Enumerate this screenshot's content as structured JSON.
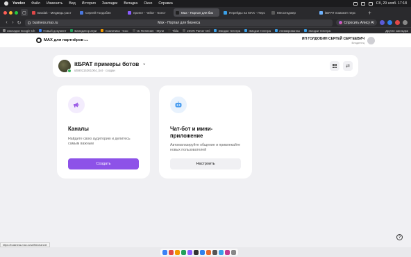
{
  "menubar": {
    "app": "Yandex",
    "items": [
      "Файл",
      "Изменить",
      "Вид",
      "История",
      "Закладки",
      "Вкладка",
      "Окно",
      "Справка"
    ],
    "clock": "Сб, 29 нояб. 17:18"
  },
  "tabs": [
    {
      "label": "Bardak - Медведь-раст",
      "color": "#e04848"
    },
    {
      "label": "Сергей Голдобин",
      "color": "#4a78e0"
    },
    {
      "label": "проект - чейот - Конст",
      "color": "#8a5cff"
    },
    {
      "label": "Max - Портал для биз",
      "color": "#222222",
      "active": true
    },
    {
      "label": "Перейды на MAX - Перс",
      "color": "#3aa0e8"
    },
    {
      "label": "Мессенджер",
      "color": "#5a5a5a"
    },
    {
      "label": "itБРАТ поможет перс",
      "color": "#6fb3ff"
    }
  ],
  "addressbar": {
    "url": "business.max.ru",
    "page_title": "Max - Портал для бизнеса",
    "alisa_label": "Спросить Алису AI"
  },
  "bookmarks": {
    "items": [
      {
        "label": "Закладки Google Ch",
        "color": "#888888"
      },
      {
        "label": "Новый документ",
        "color": "#3b82f6"
      },
      {
        "label": "Валидатор атри",
        "color": "#22a05a"
      },
      {
        "label": "Аналитика - Goo",
        "color": "#f29900"
      },
      {
        "label": "vC Restream - Мули",
        "color": "#4a4a4a"
      },
      {
        "label": "Tilda",
        "color": "#333333"
      },
      {
        "label": "JSON Parser Onl",
        "color": "#555555"
      },
      {
        "label": "Эмодзи телегра",
        "color": "#3aa0e8"
      },
      {
        "label": "Эмодзи телегра",
        "color": "#3aa0e8"
      },
      {
        "label": "Анимированны",
        "color": "#3aa0e8"
      },
      {
        "label": "Эмодзи телегра",
        "color": "#3aa0e8"
      }
    ],
    "other": "Другие закладки"
  },
  "header": {
    "logo_text": "MAX для партнёров",
    "logo_sup": "beta",
    "user_name": "ИП ГОЛДОБИН СЕРГЕЙ СЕРГЕЕВИЧ",
    "user_role": "Владелец"
  },
  "bot": {
    "name": "itБРАТ примеры ботов",
    "id_line": "id590115261004_bot · создан"
  },
  "cards": {
    "channels": {
      "title": "Каналы",
      "desc": "Найдите свою аудиторию и делитесь самым важным",
      "button": "Создать"
    },
    "chatbot": {
      "title": "Чат-бот и мини-приложение",
      "desc": "Автоматизируйте общение и привлекайте новых пользователей",
      "button": "Настроить"
    }
  },
  "help": "?",
  "status_url": "https://business.max.ru/self/#/channel",
  "colors": {
    "accent": "#8d52e8",
    "online": "#32b358"
  }
}
